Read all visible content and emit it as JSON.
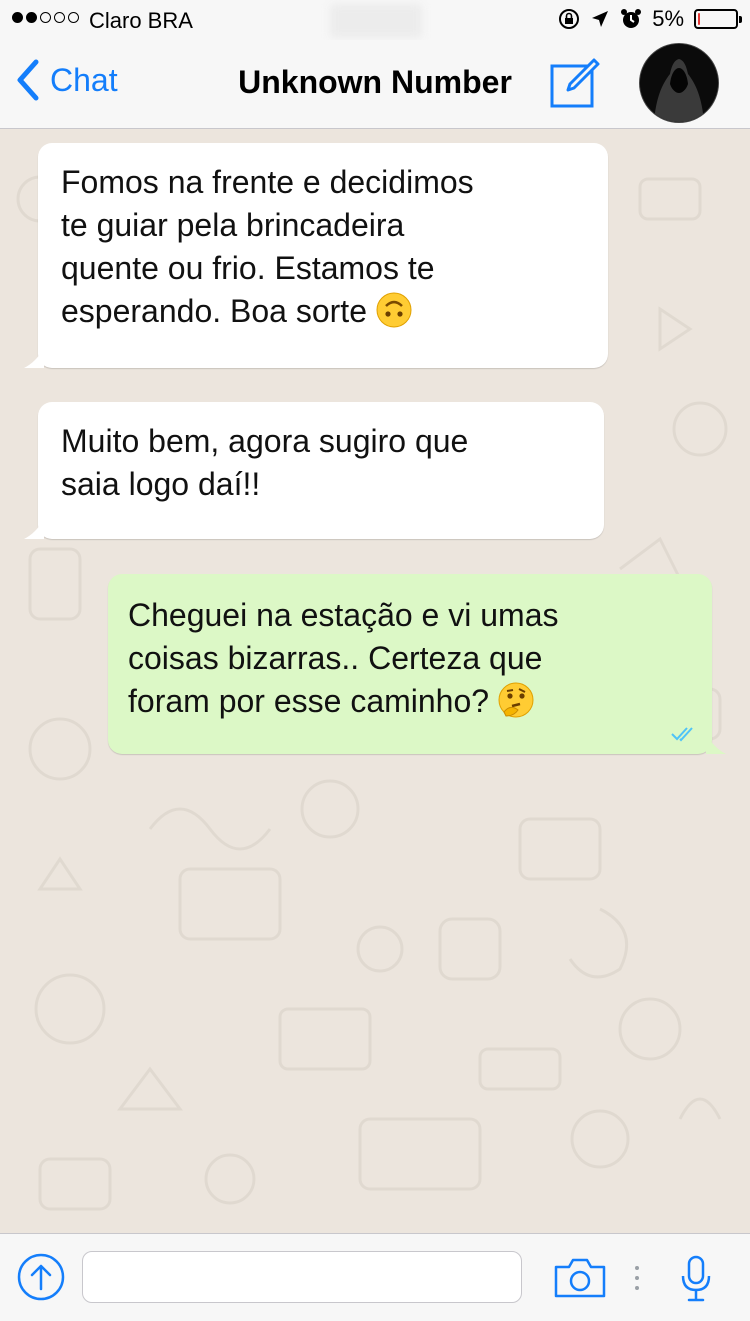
{
  "status": {
    "carrier": "Claro BRA",
    "signal_full": 2,
    "signal_total": 5,
    "battery_percent": "5%",
    "battery_level": 0.05
  },
  "nav": {
    "back_label": "Chat",
    "title": "Unknown Number"
  },
  "messages": [
    {
      "direction": "in",
      "lines": [
        "Fomos na frente e decidimos",
        "te guiar pela brincadeira",
        "quente ou frio. Estamos te",
        "esperando. Boa sorte"
      ],
      "emoji": "upside-down-face-emoji"
    },
    {
      "direction": "in",
      "lines": [
        "Muito bem, agora sugiro que",
        "saia logo daí!!"
      ]
    },
    {
      "direction": "out",
      "lines": [
        "Cheguei na estação e vi umas",
        "coisas bizarras.. Certeza que",
        "foram por esse caminho?"
      ],
      "emoji": "thinking-face-emoji",
      "status": "read"
    }
  ],
  "input": {
    "placeholder": ""
  },
  "colors": {
    "accent": "#147efb",
    "outgoing_bubble": "#dcf8c6",
    "incoming_bubble": "#ffffff",
    "chat_background": "#ece5dd",
    "read_ticks": "#4fc3f7",
    "battery_low": "#e53935"
  },
  "icons": [
    "back-chevron-icon",
    "compose-icon",
    "upload-icon",
    "camera-icon",
    "microphone-icon",
    "location-arrow-icon",
    "alarm-icon",
    "rotation-lock-icon"
  ]
}
